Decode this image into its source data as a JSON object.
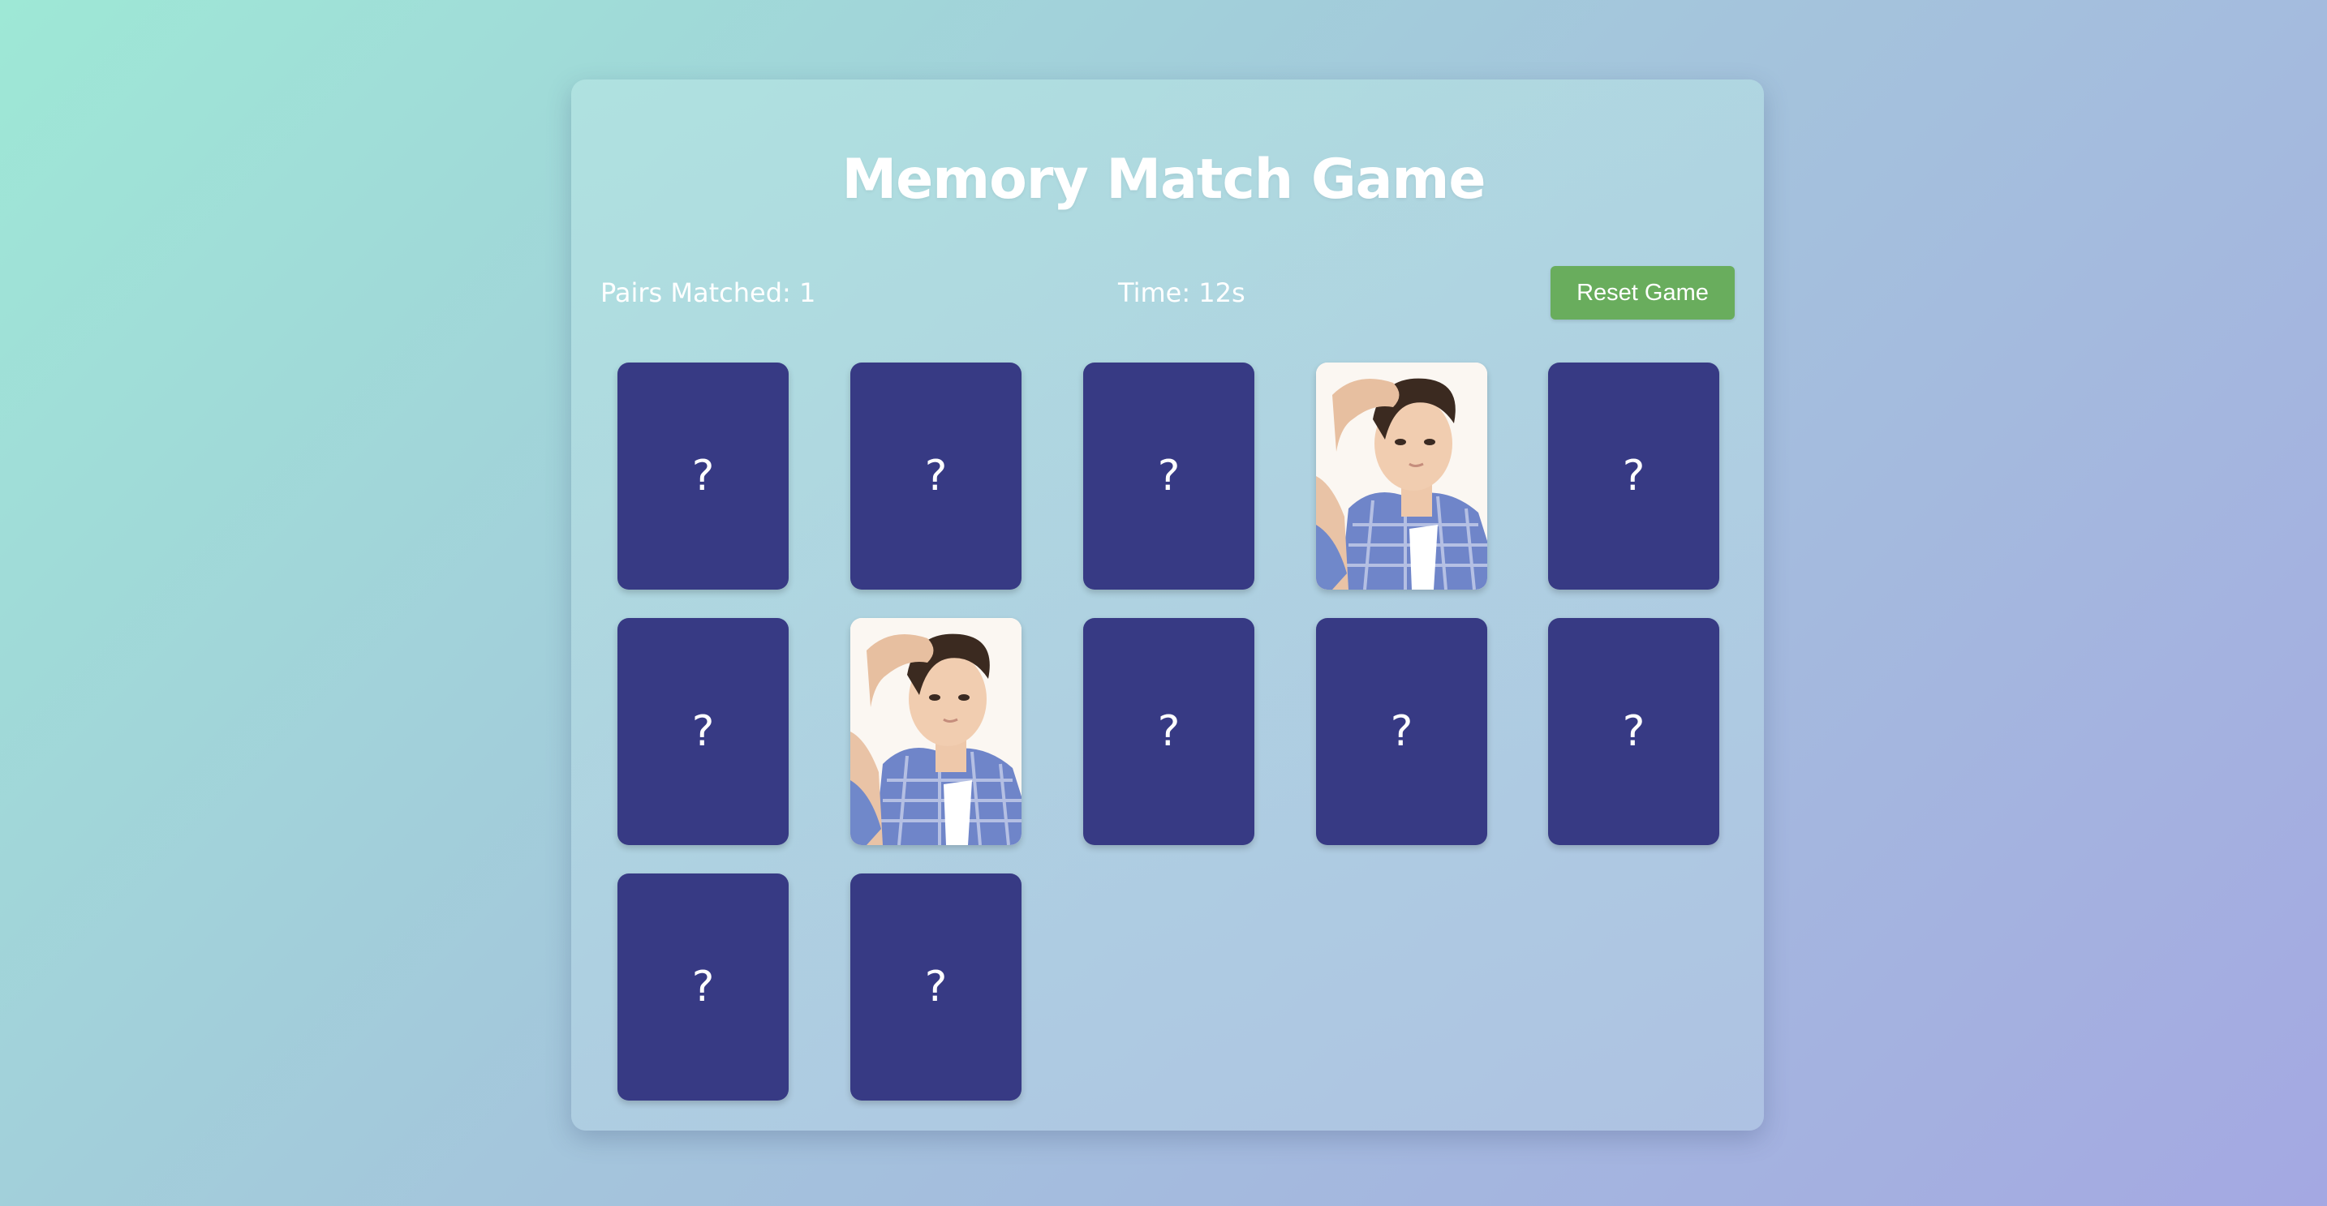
{
  "game": {
    "title": "Memory Match Game",
    "pairs_label": "Pairs Matched: 1",
    "time_label": "Time: 12s",
    "reset_label": "Reset Game",
    "pairs_matched": 1,
    "time_seconds": 12
  },
  "colors": {
    "card_back": "#373a84",
    "reset_button": "#69ad5d",
    "text": "#ffffff"
  },
  "cards": [
    {
      "state": "hidden",
      "label": "?"
    },
    {
      "state": "hidden",
      "label": "?"
    },
    {
      "state": "hidden",
      "label": "?"
    },
    {
      "state": "revealed",
      "image": "person-photo"
    },
    {
      "state": "hidden",
      "label": "?"
    },
    {
      "state": "hidden",
      "label": "?"
    },
    {
      "state": "revealed",
      "image": "person-photo"
    },
    {
      "state": "hidden",
      "label": "?"
    },
    {
      "state": "hidden",
      "label": "?"
    },
    {
      "state": "hidden",
      "label": "?"
    },
    {
      "state": "hidden",
      "label": "?"
    },
    {
      "state": "hidden",
      "label": "?"
    }
  ]
}
